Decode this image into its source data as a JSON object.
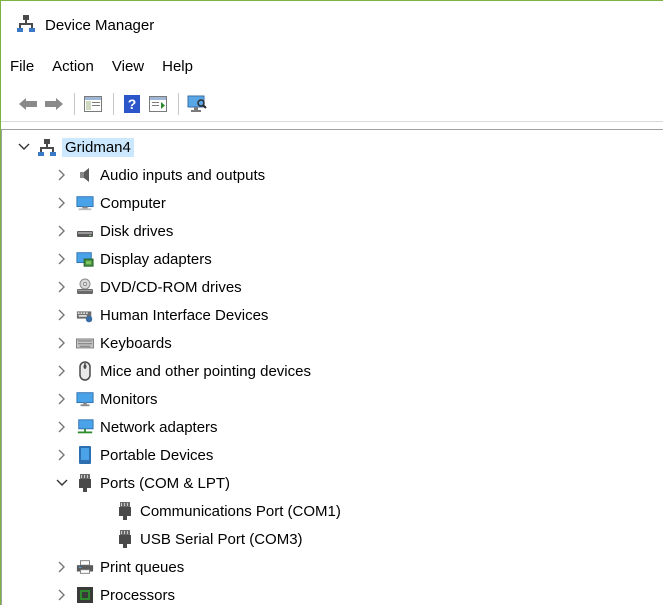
{
  "window": {
    "title": "Device Manager"
  },
  "menu": [
    "File",
    "Action",
    "View",
    "Help"
  ],
  "toolbar": {
    "buttons": [
      "back-icon",
      "forward-icon",
      "show-hide-console-tree-icon",
      "help-icon",
      "properties-icon",
      "scan-hardware-icon"
    ]
  },
  "tree": {
    "root": {
      "label": "Gridman4",
      "expanded": true
    },
    "items": [
      {
        "label": "Audio inputs and outputs",
        "icon": "speaker-icon",
        "expanded": false
      },
      {
        "label": "Computer",
        "icon": "computer-icon",
        "expanded": false
      },
      {
        "label": "Disk drives",
        "icon": "disk-drive-icon",
        "expanded": false
      },
      {
        "label": "Display adapters",
        "icon": "display-adapter-icon",
        "expanded": false
      },
      {
        "label": "DVD/CD-ROM drives",
        "icon": "dvd-drive-icon",
        "expanded": false
      },
      {
        "label": "Human Interface Devices",
        "icon": "hid-icon",
        "expanded": false
      },
      {
        "label": "Keyboards",
        "icon": "keyboard-icon",
        "expanded": false
      },
      {
        "label": "Mice and other pointing devices",
        "icon": "mouse-icon",
        "expanded": false
      },
      {
        "label": "Monitors",
        "icon": "monitor-icon",
        "expanded": false
      },
      {
        "label": "Network adapters",
        "icon": "network-adapter-icon",
        "expanded": false
      },
      {
        "label": "Portable Devices",
        "icon": "portable-device-icon",
        "expanded": false
      },
      {
        "label": "Ports (COM & LPT)",
        "icon": "port-icon",
        "expanded": true,
        "children": [
          {
            "label": "Communications Port (COM1)",
            "icon": "port-icon"
          },
          {
            "label": "USB Serial Port (COM3)",
            "icon": "port-icon"
          }
        ]
      },
      {
        "label": "Print queues",
        "icon": "printer-icon",
        "expanded": false
      },
      {
        "label": "Processors",
        "icon": "processor-icon",
        "expanded": false
      }
    ]
  },
  "colors": {
    "selection": "#cce8ff",
    "window_border": "#7bb340"
  }
}
